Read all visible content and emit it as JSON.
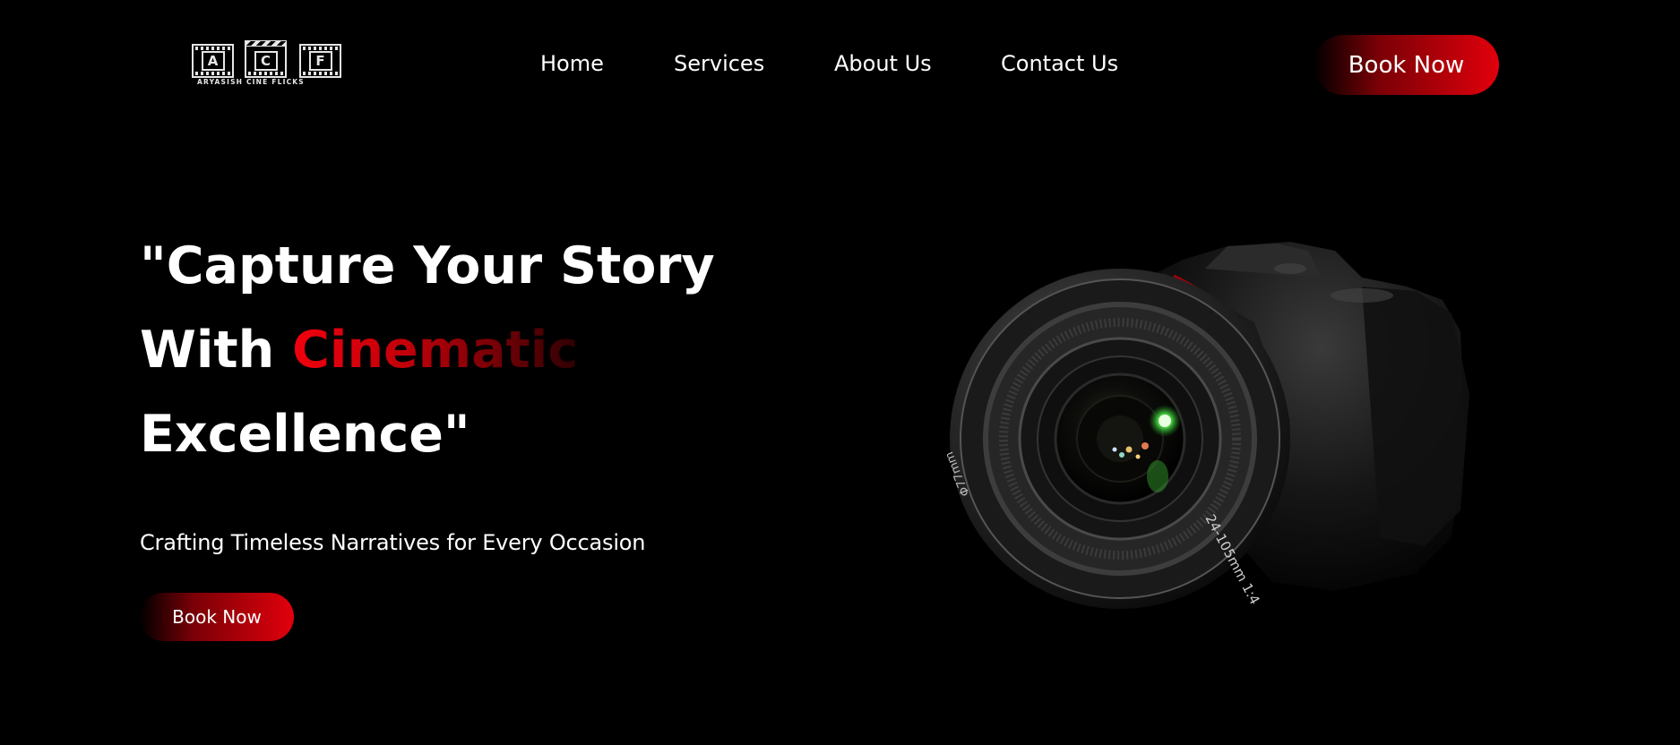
{
  "brand": {
    "logo_letters": [
      "A",
      "C",
      "F"
    ],
    "logo_text": "ARYASISH CINE FLICKS"
  },
  "nav": {
    "items": [
      {
        "label": "Home"
      },
      {
        "label": "Services"
      },
      {
        "label": "About Us"
      },
      {
        "label": "Contact Us"
      }
    ],
    "cta_label": "Book Now"
  },
  "hero": {
    "headline_line1": "\"Capture Your Story",
    "headline_line2_prefix": "With ",
    "headline_line2_accent": "Cinematic",
    "headline_line3": "Excellence\"",
    "subtitle": "Crafting Timeless Narratives for Every Occasion",
    "cta_label": "Book Now"
  },
  "camera": {
    "lens_marking_1": "24-105mm 1:4",
    "lens_marking_2": "Φ77mm"
  },
  "colors": {
    "background": "#000000",
    "accent": "#e1000c",
    "text": "#ffffff"
  }
}
